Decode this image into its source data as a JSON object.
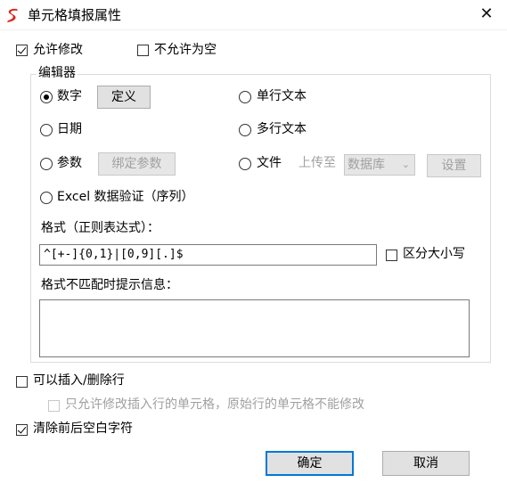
{
  "window": {
    "title": "单元格填报属性",
    "close_glyph": "✕"
  },
  "options": {
    "allow_modify": "允许修改",
    "disallow_empty": "不允许为空"
  },
  "editor": {
    "group_label": "编辑器",
    "number": "数字",
    "define_button": "定义",
    "single_line": "单行文本",
    "date": "日期",
    "multi_line": "多行文本",
    "param": "参数",
    "bind_param_button": "绑定参数",
    "file": "文件",
    "upload_to": "上传至",
    "upload_target": "数据库",
    "settings_button": "设置",
    "excel_validation": "Excel 数据验证（序列）",
    "format_label": "格式（正则表达式）：",
    "format_value": "^[+-]{0,1}|[0,9][.]$",
    "case_sensitive": "区分大小写",
    "mismatch_label": "格式不匹配时提示信息：",
    "mismatch_value": ""
  },
  "rows": {
    "insert_delete": "可以插入/删除行",
    "only_inserted": "只允许修改插入行的单元格，原始行的单元格不能修改",
    "trim_spaces": "清除前后空白字符"
  },
  "buttons": {
    "ok": "确定",
    "cancel": "取消"
  },
  "state": {
    "allow_modify_checked": true,
    "disallow_empty_checked": false,
    "editor_selected": "数字",
    "case_sensitive_checked": false,
    "insert_delete_checked": false,
    "only_inserted_checked": false,
    "trim_spaces_checked": true
  }
}
